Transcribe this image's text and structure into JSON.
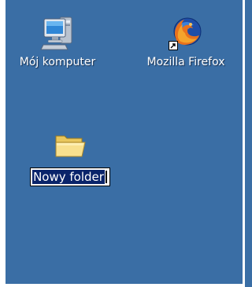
{
  "desktop": {
    "background": "#3a6ea5",
    "icons": [
      {
        "label": "Mój komputer",
        "icon": "my-computer-icon"
      },
      {
        "label": "Mozilla Firefox",
        "icon": "firefox-icon",
        "shortcut": true
      },
      {
        "label": "Nowy folder",
        "icon": "folder-icon",
        "renaming": true
      }
    ]
  }
}
